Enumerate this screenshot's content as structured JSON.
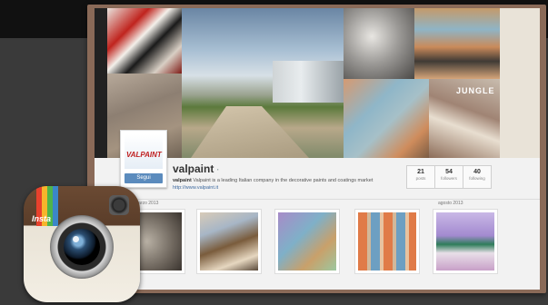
{
  "profile": {
    "username": "valpaint",
    "verified_mark": "·",
    "logo_text": "VALPAINT",
    "follow_label": "Segui",
    "bio_name": "valpaint",
    "bio_text": "Valpaint is a leading Italian company in the decorative paints and coatings market",
    "bio_link": "http://www.valpaint.it"
  },
  "stats": [
    {
      "value": "21",
      "label": "posts"
    },
    {
      "value": "54",
      "label": "followers"
    },
    {
      "value": "40",
      "label": "following"
    }
  ],
  "banner": {
    "tile_text": "JUNGLE"
  },
  "feed": {
    "section_label_left": "marzo 2013",
    "section_label_right": "agosto 2013"
  },
  "app_icon": {
    "label": "Insta",
    "stripe_colors": [
      "#e8412c",
      "#f6b52b",
      "#4fb44a",
      "#3b86c8"
    ]
  },
  "colors": {
    "frame": "#8a6a58",
    "follow_button": "#5b8bbd",
    "link": "#3e6aa0"
  }
}
